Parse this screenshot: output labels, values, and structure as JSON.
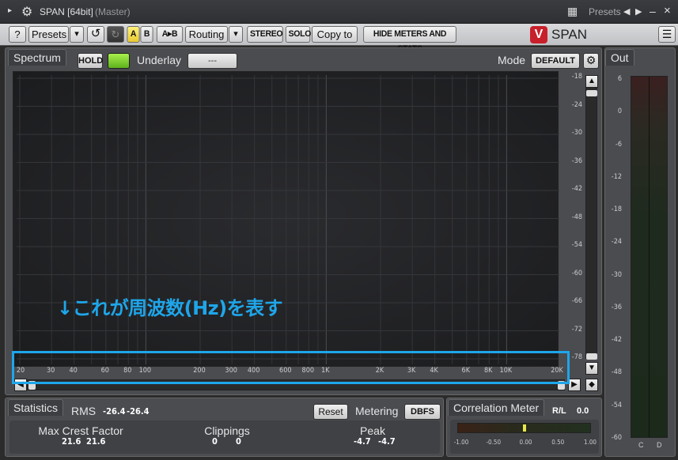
{
  "window": {
    "title": "SPAN [64bit]",
    "subtitle": "(Master)",
    "presets_label": "Presets"
  },
  "toolbar": {
    "help": "?",
    "presets": "Presets",
    "dropdown": "▾",
    "undo": "↺",
    "a": "A",
    "b": "B",
    "ab": "A▸B",
    "routing": "Routing",
    "stereo": "STEREO",
    "solo": "SOLO",
    "copy_to": "Copy to",
    "hide": "HIDE METERS AND STATS",
    "brand": "SPAN",
    "menu": "☰"
  },
  "spectrum": {
    "tab": "Spectrum",
    "hold": "HOLD",
    "underlay_label": "Underlay",
    "underlay_value": "---",
    "mode_label": "Mode",
    "mode_value": "DEFAULT",
    "y_ticks": [
      "-18",
      "-24",
      "-30",
      "-36",
      "-42",
      "-48",
      "-54",
      "-60",
      "-66",
      "-72",
      "-78"
    ],
    "x_ticks": [
      "20",
      "30",
      "40",
      "60",
      "80",
      "100",
      "200",
      "300",
      "400",
      "600",
      "800",
      "1K",
      "2K",
      "3K",
      "4K",
      "6K",
      "8K",
      "10K",
      "20K"
    ],
    "annotation": "↓これが周波数(Hz)を表す"
  },
  "output": {
    "tab": "Out",
    "ticks": [
      "6",
      "0",
      "-6",
      "-12",
      "-18",
      "-24",
      "-30",
      "-36",
      "-42",
      "-48",
      "-54",
      "-60"
    ],
    "channels": [
      "C",
      "D"
    ]
  },
  "statistics": {
    "tab": "Statistics",
    "rms_label": "RMS",
    "rms_l": "-26.4",
    "rms_r": "-26.4",
    "reset": "Reset",
    "metering_label": "Metering",
    "metering_value": "DBFS",
    "crest_label": "Max Crest Factor",
    "crest_l": "21.6",
    "crest_r": "21.6",
    "clip_label": "Clippings",
    "clip_l": "0",
    "clip_r": "0",
    "peak_label": "Peak",
    "peak_l": "-4.7",
    "peak_r": "-4.7"
  },
  "correlation": {
    "tab": "Correlation Meter",
    "rl_label": "R/L",
    "rl_value": "0.0",
    "ticks": [
      "-1.00",
      "-0.50",
      "0.00",
      "0.50",
      "1.00"
    ]
  },
  "colors": {
    "accent": "#1ea6ea",
    "hold_led": "#7ed321",
    "brand_red": "#c8202a"
  }
}
